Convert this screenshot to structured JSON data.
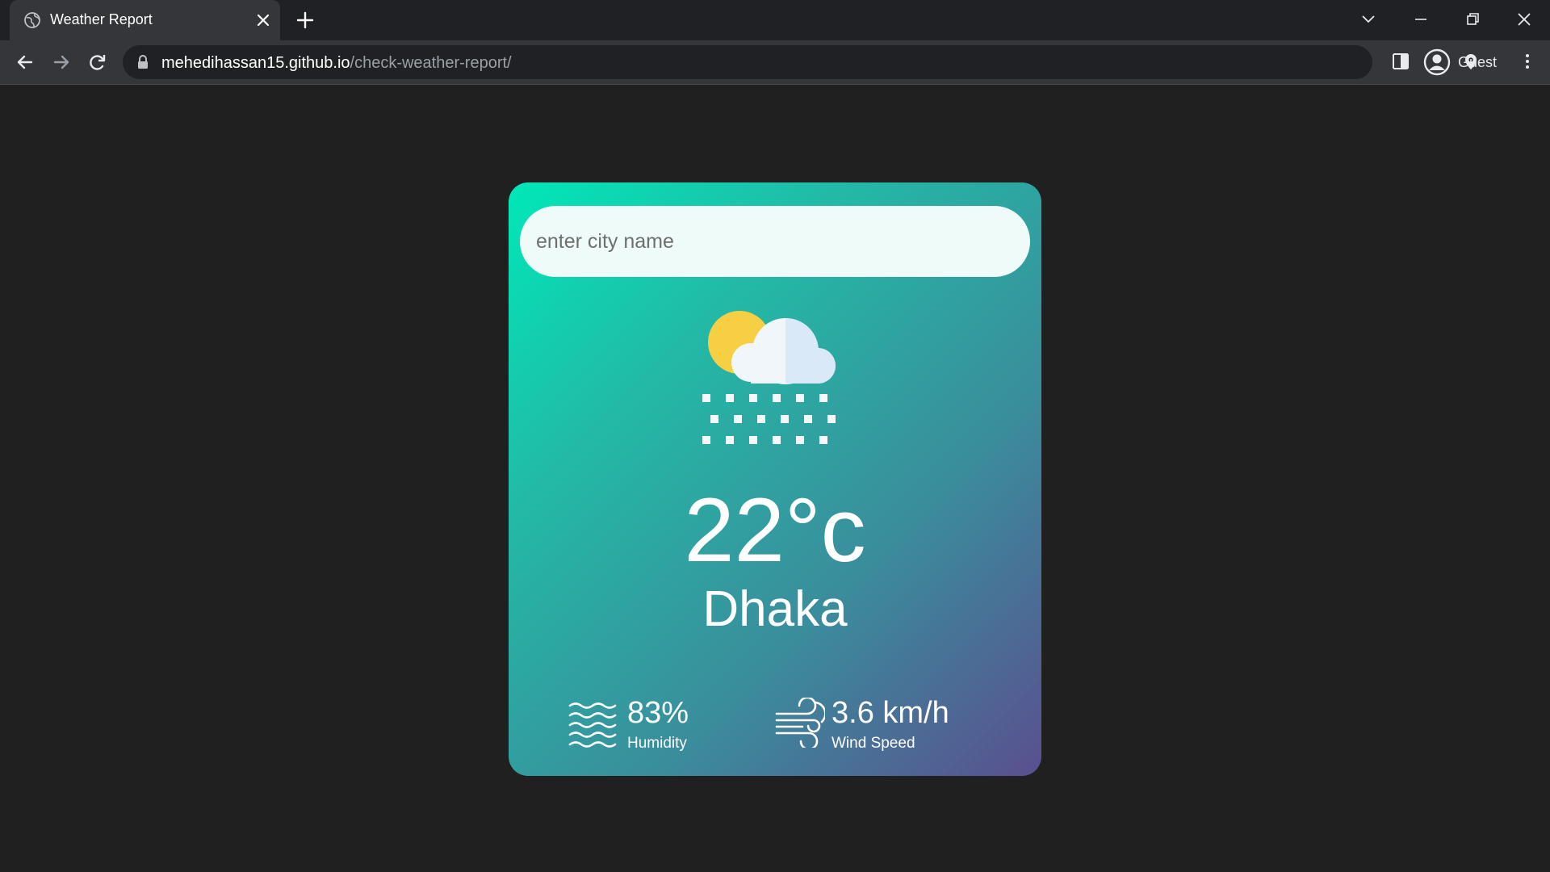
{
  "browser": {
    "tab": {
      "title": "Weather Report"
    },
    "address_bar": {
      "host": "mehedihassan15.github.io",
      "path": "/check-weather-report/"
    },
    "profile": {
      "label": "Guest"
    },
    "icons": {
      "favicon": "globe-icon",
      "close": "close-icon",
      "new_tab": "plus-icon",
      "back": "arrow-left-icon",
      "forward": "arrow-right-icon",
      "reload": "reload-icon",
      "lock": "lock-icon",
      "location": "location-pin-icon",
      "side_panel": "side-panel-icon",
      "menu": "kebab-menu-icon"
    }
  },
  "weather": {
    "search": {
      "placeholder": "enter city name",
      "value": ""
    },
    "condition_icon": "sun-cloud-snow-icon",
    "temperature": "22°c",
    "city": "Dhaka",
    "humidity": {
      "value": "83%",
      "label": "Humidity",
      "icon": "humidity-waves-icon"
    },
    "wind": {
      "value": "3.6 km/h",
      "label": "Wind Speed",
      "icon": "wind-icon"
    }
  },
  "colors": {
    "page_background": "#202020",
    "card_gradient_start": "#00e8b8",
    "card_gradient_end": "#5a4f8f",
    "sun": "#f7cf43",
    "cloud": "#e3f0fb"
  }
}
